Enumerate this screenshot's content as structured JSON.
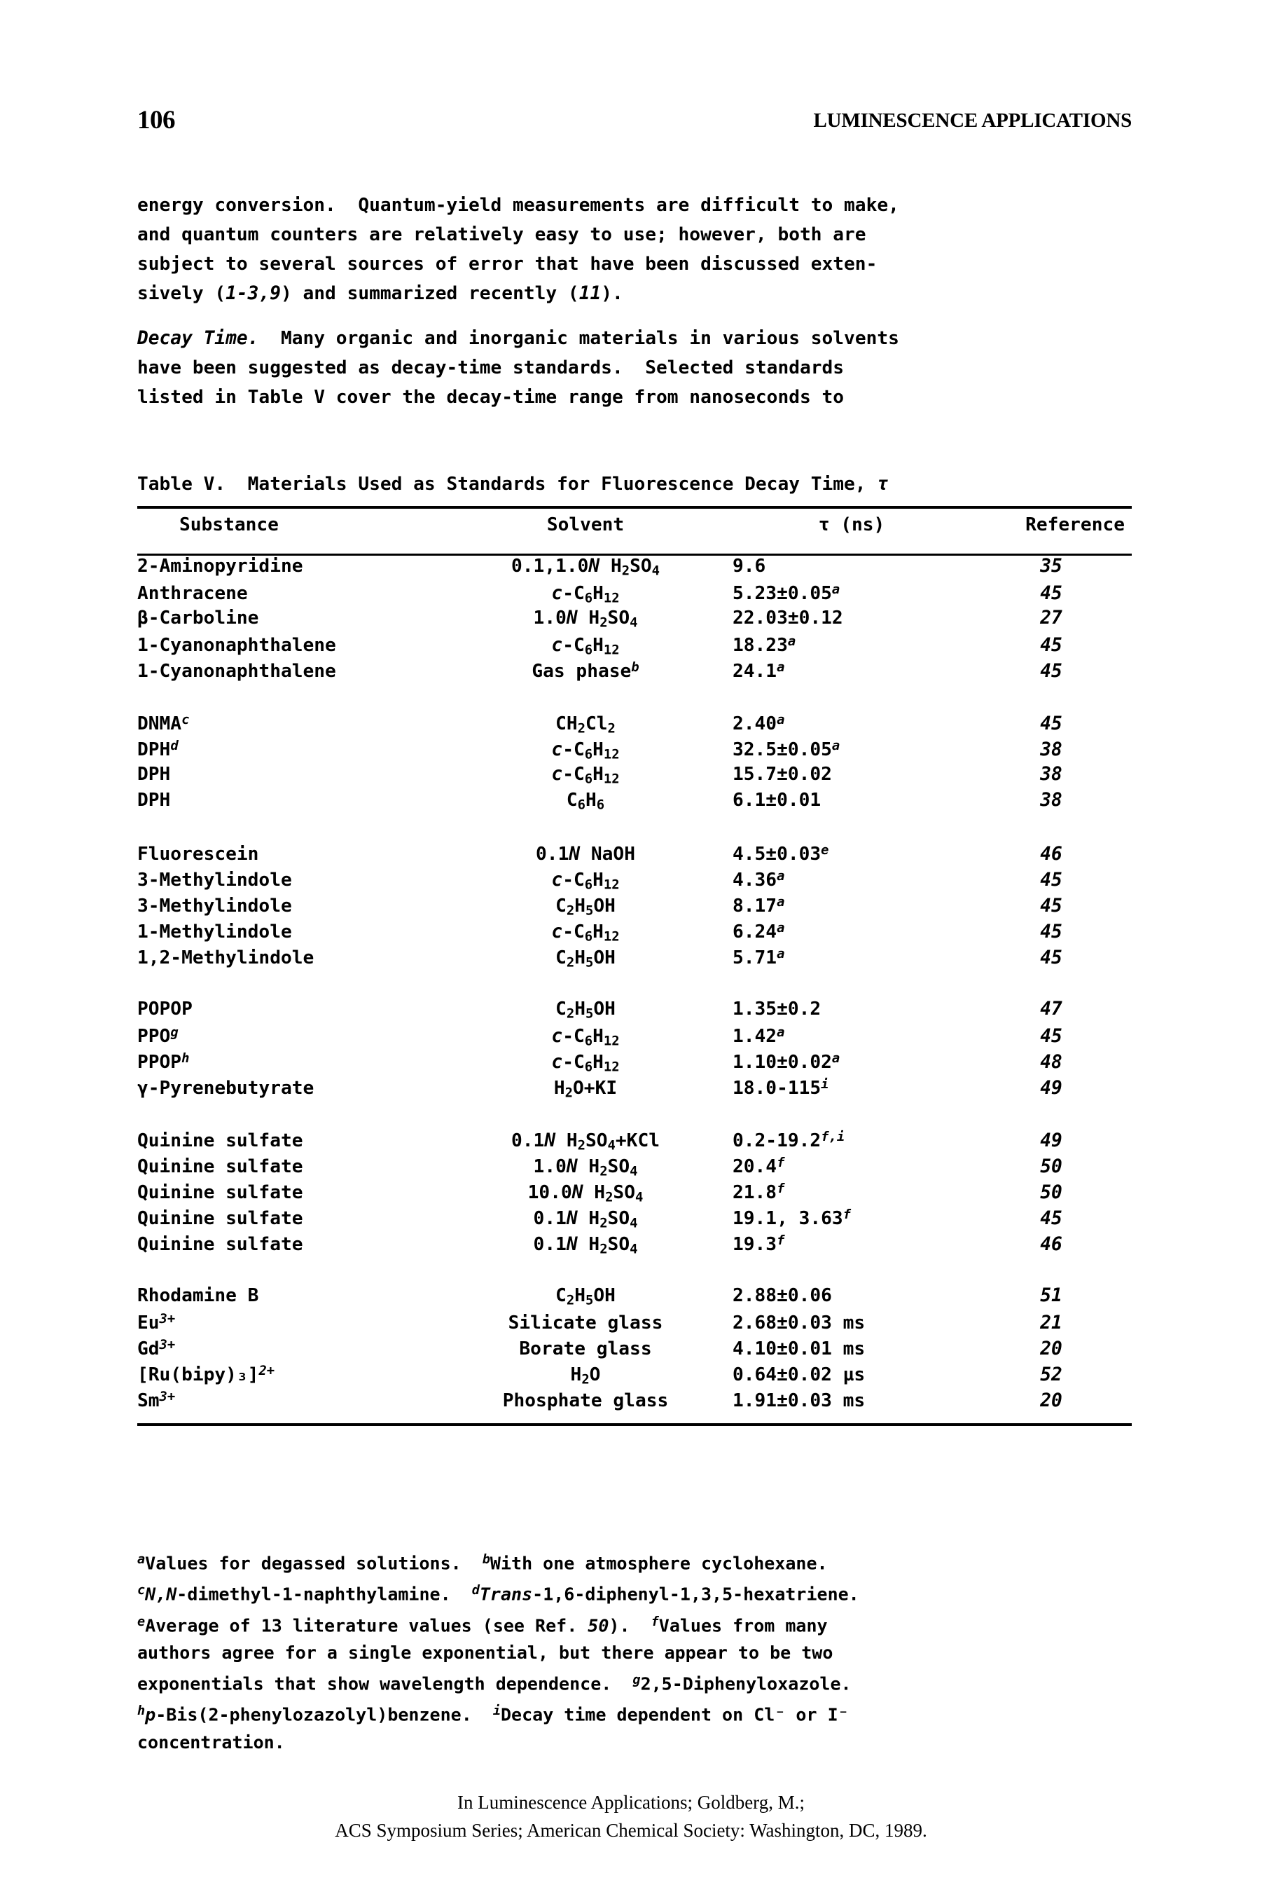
{
  "runhead": {
    "folio": "106",
    "title": "LUMINESCENCE APPLICATIONS"
  },
  "paragraphs": {
    "p1_line1": "energy conversion.  Quantum-yield measurements are difficult to make,",
    "p1_line2": "and quantum counters are relatively easy to use; however, both are",
    "p1_line3": "subject to several sources of error that have been discussed exten-",
    "p1_line4_a": "sively (",
    "p1_line4_i": "1-3,9",
    "p1_line4_b": ") and summarized recently (",
    "p1_line4_i2": "11",
    "p1_line4_c": ").",
    "p2_head": "Decay Time.",
    "p2_line1": "  Many organic and inorganic materials in various solvents",
    "p2_line2": "have been suggested as decay-time standards.  Selected standards",
    "p2_line3": "listed in Table V cover the decay-time range from nanoseconds to"
  },
  "table": {
    "caption_a": "Table V.  Materials Used as Standards for Fluorescence Decay Time, ",
    "caption_tau": "τ",
    "headers": {
      "substance": "Substance",
      "solvent": "Solvent",
      "tau": "τ (ns)",
      "reference": "Reference"
    },
    "groups": [
      {
        "rows": [
          {
            "substance": "2-Aminopyridine",
            "sub_sup": "",
            "solvent_html": "0.1,1.0<i>N</i> H<sub>2</sub>SO<sub>4</sub>",
            "solvent_sup": "",
            "tau": "9.6",
            "tau_sup": "",
            "reference": "35"
          },
          {
            "substance": "Anthracene",
            "sub_sup": "",
            "solvent_html": "<i>c</i>-C<sub>6</sub>H<sub>12</sub>",
            "solvent_sup": "",
            "tau": "5.23±0.05",
            "tau_sup": "a",
            "reference": "45"
          },
          {
            "substance": "β-Carboline",
            "sub_sup": "",
            "solvent_html": "1.0<i>N</i> H<sub>2</sub>SO<sub>4</sub>",
            "solvent_sup": "",
            "tau": "22.03±0.12",
            "tau_sup": "",
            "reference": "27"
          },
          {
            "substance": "1-Cyanonaphthalene",
            "sub_sup": "",
            "solvent_html": "<i>c</i>-C<sub>6</sub>H<sub>12</sub>",
            "solvent_sup": "",
            "tau": "18.23",
            "tau_sup": "a",
            "reference": "45"
          },
          {
            "substance": "1-Cyanonaphthalene",
            "sub_sup": "",
            "solvent_html": "Gas phase",
            "solvent_sup": "b",
            "tau": "24.1",
            "tau_sup": "a",
            "reference": "45"
          }
        ]
      },
      {
        "rows": [
          {
            "substance": "DNMA",
            "sub_sup": "c",
            "solvent_html": "CH<sub>2</sub>Cl<sub>2</sub>",
            "solvent_sup": "",
            "tau": "2.40",
            "tau_sup": "a",
            "reference": "45"
          },
          {
            "substance": "DPH",
            "sub_sup": "d",
            "solvent_html": "<i>c</i>-C<sub>6</sub>H<sub>12</sub>",
            "solvent_sup": "",
            "tau": "32.5±0.05",
            "tau_sup": "a",
            "reference": "38"
          },
          {
            "substance": "DPH",
            "sub_sup": "",
            "solvent_html": "<i>c</i>-C<sub>6</sub>H<sub>12</sub>",
            "solvent_sup": "",
            "tau": "15.7±0.02",
            "tau_sup": "",
            "reference": "38"
          },
          {
            "substance": "DPH",
            "sub_sup": "",
            "solvent_html": "C<sub>6</sub>H<sub>6</sub>",
            "solvent_sup": "",
            "tau": "6.1±0.01",
            "tau_sup": "",
            "reference": "38"
          }
        ]
      },
      {
        "rows": [
          {
            "substance": "Fluorescein",
            "sub_sup": "",
            "solvent_html": "0.1<i>N</i> NaOH",
            "solvent_sup": "",
            "tau": "4.5±0.03",
            "tau_sup": "e",
            "reference": "46"
          },
          {
            "substance": "3-Methylindole",
            "sub_sup": "",
            "solvent_html": "<i>c</i>-C<sub>6</sub>H<sub>12</sub>",
            "solvent_sup": "",
            "tau": "4.36",
            "tau_sup": "a",
            "reference": "45"
          },
          {
            "substance": "3-Methylindole",
            "sub_sup": "",
            "solvent_html": "C<sub>2</sub>H<sub>5</sub>OH",
            "solvent_sup": "",
            "tau": "8.17",
            "tau_sup": "a",
            "reference": "45"
          },
          {
            "substance": "1-Methylindole",
            "sub_sup": "",
            "solvent_html": "<i>c</i>-C<sub>6</sub>H<sub>12</sub>",
            "solvent_sup": "",
            "tau": "6.24",
            "tau_sup": "a",
            "reference": "45"
          },
          {
            "substance": "1,2-Methylindole",
            "sub_sup": "",
            "solvent_html": "C<sub>2</sub>H<sub>5</sub>OH",
            "solvent_sup": "",
            "tau": "5.71",
            "tau_sup": "a",
            "reference": "45"
          }
        ]
      },
      {
        "rows": [
          {
            "substance": "POPOP",
            "sub_sup": "",
            "solvent_html": "C<sub>2</sub>H<sub>5</sub>OH",
            "solvent_sup": "",
            "tau": "1.35±0.2",
            "tau_sup": "",
            "reference": "47"
          },
          {
            "substance": "PPO",
            "sub_sup": "g",
            "solvent_html": "<i>c</i>-C<sub>6</sub>H<sub>12</sub>",
            "solvent_sup": "",
            "tau": "1.42",
            "tau_sup": "a",
            "reference": "45"
          },
          {
            "substance": "PPOP",
            "sub_sup": "h",
            "solvent_html": "<i>c</i>-C<sub>6</sub>H<sub>12</sub>",
            "solvent_sup": "",
            "tau": "1.10±0.02",
            "tau_sup": "a",
            "reference": "48"
          },
          {
            "substance": "γ-Pyrenebutyrate",
            "sub_sup": "",
            "solvent_html": "H<sub>2</sub>O+KI",
            "solvent_sup": "",
            "tau": "18.0-115",
            "tau_sup": "i",
            "reference": "49"
          }
        ]
      },
      {
        "rows": [
          {
            "substance": "Quinine sulfate",
            "sub_sup": "",
            "solvent_html": "0.1<i>N</i> H<sub>2</sub>SO<sub>4</sub>+KCl",
            "solvent_sup": "",
            "tau": "0.2-19.2",
            "tau_sup": "f,i",
            "reference": "49"
          },
          {
            "substance": "Quinine sulfate",
            "sub_sup": "",
            "solvent_html": "1.0<i>N</i> H<sub>2</sub>SO<sub>4</sub>",
            "solvent_sup": "",
            "tau": "20.4",
            "tau_sup": "f",
            "reference": "50"
          },
          {
            "substance": "Quinine sulfate",
            "sub_sup": "",
            "solvent_html": "10.0<i>N</i> H<sub>2</sub>SO<sub>4</sub>",
            "solvent_sup": "",
            "tau": "21.8",
            "tau_sup": "f",
            "reference": "50"
          },
          {
            "substance": "Quinine sulfate",
            "sub_sup": "",
            "solvent_html": "0.1<i>N</i> H<sub>2</sub>SO<sub>4</sub>",
            "solvent_sup": "",
            "tau": "19.1, 3.63",
            "tau_sup": "f",
            "reference": "45"
          },
          {
            "substance": "Quinine sulfate",
            "sub_sup": "",
            "solvent_html": "0.1<i>N</i> H<sub>2</sub>SO<sub>4</sub>",
            "solvent_sup": "",
            "tau": "19.3",
            "tau_sup": "f",
            "reference": "46"
          }
        ]
      },
      {
        "rows": [
          {
            "substance": "Rhodamine B",
            "sub_sup": "",
            "solvent_html": "C<sub>2</sub>H<sub>5</sub>OH",
            "solvent_sup": "",
            "tau": "2.88±0.06",
            "tau_sup": "",
            "reference": "51"
          },
          {
            "substance": "Eu",
            "sub_sup": "3+",
            "solvent_html": "Silicate glass",
            "solvent_sup": "",
            "tau": "2.68±0.03 ms",
            "tau_sup": "",
            "reference": "21"
          },
          {
            "substance": "Gd",
            "sub_sup": "3+",
            "solvent_html": "Borate glass",
            "solvent_sup": "",
            "tau": "4.10±0.01 ms",
            "tau_sup": "",
            "reference": "20"
          },
          {
            "substance": "[Ru(bipy)₃]",
            "sub_sup": "2+",
            "solvent_html": "H<sub>2</sub>O",
            "solvent_sup": "",
            "tau": "0.64±0.02 µs",
            "tau_sup": "",
            "reference": "52"
          },
          {
            "substance": "Sm",
            "sub_sup": "3+",
            "solvent_html": "Phosphate glass",
            "solvent_sup": "",
            "tau": "1.91±0.03 ms",
            "tau_sup": "",
            "reference": "20"
          }
        ]
      }
    ]
  },
  "footnotes": {
    "a_marker": "a",
    "a_text": "Values for degassed solutions.  ",
    "b_marker": "b",
    "b_text": "With one atmosphere cyclohexane.\n",
    "c_marker": "c",
    "c_text_i": "N,N",
    "c_text": "-dimethyl-1-naphthylamine.  ",
    "d_marker": "d",
    "d_text_i": "Trans",
    "d_text": "-1,6-diphenyl-1,3,5-hexatriene.\n",
    "e_marker": "e",
    "e_text_a": "Average of 13 literature values (see Ref. ",
    "e_text_i": "50",
    "e_text_b": ").  ",
    "f_marker": "f",
    "f_text": "Values from many\nauthors agree for a single exponential, but there appear to be two\nexponentials that show wavelength dependence.  ",
    "g_marker": "g",
    "g_text": "2,5-Diphenyloxazole.\n",
    "h_marker": "h",
    "h_text_i": "p",
    "h_text": "-Bis(2-phenylozazolyl)benzene.  ",
    "i_marker": "i",
    "i_text": "Decay time dependent on Cl⁻ or I⁻\nconcentration."
  },
  "pagefooter": {
    "line1": "In Luminescence Applications; Goldberg, M.;",
    "line2": "ACS Symposium Series; American Chemical Society: Washington, DC, 1989."
  }
}
